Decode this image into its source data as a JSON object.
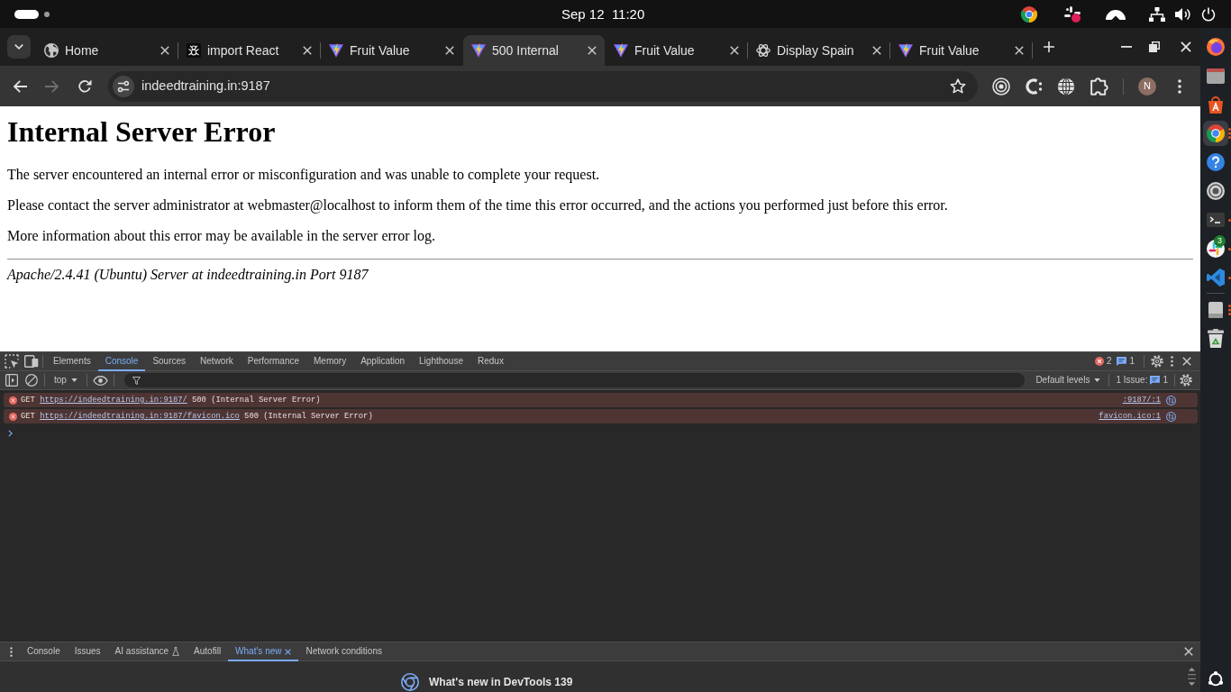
{
  "top_bar": {
    "clock": "Sep 12  11:20"
  },
  "browser": {
    "tabs": [
      {
        "kind": "globe",
        "title": "Home",
        "selected": false
      },
      {
        "kind": "bug",
        "title": "import React",
        "selected": false
      },
      {
        "kind": "bolt",
        "title": "Fruit Value",
        "selected": false
      },
      {
        "kind": "bolt",
        "title": "500 Internal",
        "selected": true
      },
      {
        "kind": "bolt",
        "title": "Fruit Value",
        "selected": false
      },
      {
        "kind": "knot",
        "title": "Display Spain",
        "selected": false
      },
      {
        "kind": "bolt",
        "title": "Fruit Value",
        "selected": false
      }
    ],
    "back_disabled": false,
    "forward_disabled": true,
    "address": "indeedtraining.in:9187",
    "profile_initial": "N"
  },
  "page": {
    "heading": "Internal Server Error",
    "paragraphs": [
      "The server encountered an internal error or misconfiguration and was unable to complete your request.",
      "Please contact the server administrator at webmaster@localhost to inform them of the time this error occurred, and the actions you performed just before this error.",
      "More information about this error may be available in the server error log."
    ],
    "signature": "Apache/2.4.41 (Ubuntu) Server at indeedtraining.in Port 9187"
  },
  "devtools": {
    "tabs": [
      {
        "label": "Elements",
        "selected": false
      },
      {
        "label": "Console",
        "selected": true
      },
      {
        "label": "Sources",
        "selected": false
      },
      {
        "label": "Network",
        "selected": false
      },
      {
        "label": "Performance",
        "selected": false
      },
      {
        "label": "Memory",
        "selected": false
      },
      {
        "label": "Application",
        "selected": false
      },
      {
        "label": "Lighthouse",
        "selected": false
      },
      {
        "label": "Redux",
        "selected": false
      }
    ],
    "error_count": "2",
    "message_count": "1",
    "context": "top",
    "levels": "Default levels",
    "issues_label": "1 Issue:",
    "issues_count": "1",
    "messages": [
      {
        "kind": "error",
        "method": "GET",
        "url": "https://indeedtraining.in:9187/",
        "status": "500 (Internal Server Error)",
        "source": ":9187/:1"
      },
      {
        "kind": "error",
        "method": "GET",
        "url": "https://indeedtraining.in:9187/favicon.ico",
        "status": "500 (Internal Server Error)",
        "source": "favicon.ico:1"
      }
    ]
  },
  "drawer": {
    "tabs": [
      {
        "label": "Console",
        "kind": "plain",
        "selected": false,
        "closable": false
      },
      {
        "label": "Issues",
        "kind": "plain",
        "selected": false,
        "closable": false
      },
      {
        "label": "AI assistance",
        "kind": "experiment",
        "selected": false,
        "closable": false
      },
      {
        "label": "Autofill",
        "kind": "plain",
        "selected": false,
        "closable": false
      },
      {
        "label": "What's new",
        "kind": "plain",
        "selected": true,
        "closable": true
      },
      {
        "label": "Network conditions",
        "kind": "plain",
        "selected": false,
        "closable": false
      }
    ],
    "whats_new_title": "What's new in DevTools 139"
  },
  "dock": {
    "apps": [
      {
        "kind": "firefox",
        "selected": false,
        "running": false
      },
      {
        "kind": "files",
        "selected": false,
        "running": false
      },
      {
        "kind": "store",
        "selected": false,
        "running": false
      },
      {
        "kind": "chrome",
        "selected": true,
        "running": true,
        "multiple_windows": true
      },
      {
        "kind": "help",
        "selected": false,
        "running": false
      },
      {
        "kind": "disc",
        "selected": false,
        "running": false
      },
      {
        "kind": "terminal",
        "selected": false,
        "running": true,
        "multiple_windows": false
      },
      {
        "kind": "slack",
        "selected": false,
        "running": true,
        "multiple_windows": false,
        "badge": "3"
      },
      {
        "kind": "vscode",
        "selected": false,
        "running": true,
        "multiple_windows": false
      }
    ],
    "devices": [
      {
        "kind": "drive",
        "selected": false,
        "running": true,
        "multiple_windows": true
      },
      {
        "kind": "trash",
        "selected": false,
        "running": false
      }
    ]
  }
}
